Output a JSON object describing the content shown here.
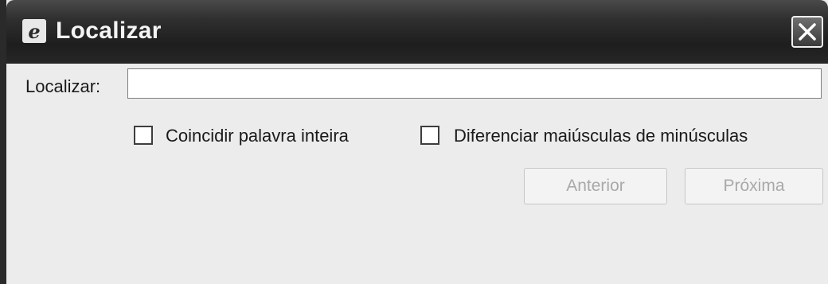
{
  "window": {
    "title": "Localizar",
    "icon": "ie-icon",
    "close_icon": "close-icon"
  },
  "find": {
    "label": "Localizar:",
    "value": "",
    "placeholder": ""
  },
  "options": {
    "whole_word_label": "Coincidir palavra inteira",
    "whole_word_checked": false,
    "match_case_label": "Diferenciar maiúsculas de minúsculas",
    "match_case_checked": false
  },
  "buttons": {
    "previous_label": "Anterior",
    "previous_enabled": false,
    "next_label": "Próxima",
    "next_enabled": false
  },
  "colors": {
    "titlebar": "#262626",
    "dialog_bg": "#ececec",
    "disabled_text": "#a9a9a9"
  }
}
